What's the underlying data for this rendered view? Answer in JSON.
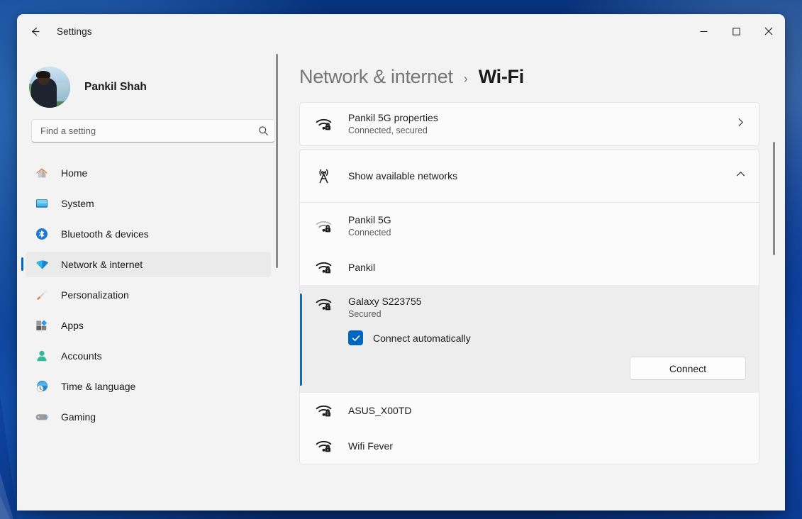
{
  "window": {
    "title": "Settings",
    "back_icon": "back-arrow-icon",
    "minimize_label": "Minimize",
    "maximize_label": "Maximize",
    "close_label": "Close"
  },
  "sidebar": {
    "profile": {
      "name": "Pankil Shah",
      "avatar_icon": "user-avatar"
    },
    "search": {
      "placeholder": "Find a setting",
      "value": "",
      "icon": "search-icon"
    },
    "items": [
      {
        "label": "Home",
        "icon": "home-icon",
        "active": false
      },
      {
        "label": "System",
        "icon": "system-icon",
        "active": false
      },
      {
        "label": "Bluetooth & devices",
        "icon": "bluetooth-icon",
        "active": false
      },
      {
        "label": "Network & internet",
        "icon": "network-icon",
        "active": true
      },
      {
        "label": "Personalization",
        "icon": "personalization-icon",
        "active": false
      },
      {
        "label": "Apps",
        "icon": "apps-icon",
        "active": false
      },
      {
        "label": "Accounts",
        "icon": "accounts-icon",
        "active": false
      },
      {
        "label": "Time & language",
        "icon": "time-language-icon",
        "active": false
      },
      {
        "label": "Gaming",
        "icon": "gaming-icon",
        "active": false
      }
    ]
  },
  "main": {
    "breadcrumb": {
      "parent": "Network & internet",
      "separator": "›",
      "current": "Wi-Fi"
    },
    "properties_row": {
      "title": "Pankil 5G properties",
      "subtitle": "Connected, secured",
      "icon": "wifi-secured-icon",
      "chevron": "chevron-right-icon"
    },
    "show_networks_row": {
      "title": "Show available networks",
      "icon": "broadcast-tower-icon",
      "chevron": "chevron-up-icon",
      "expanded": true
    },
    "networks": [
      {
        "name": "Pankil 5G",
        "status": "Connected",
        "icon": "wifi-secured-icon",
        "selected": false,
        "signal": "weak"
      },
      {
        "name": "Pankil",
        "status": "",
        "icon": "wifi-secured-icon",
        "selected": false,
        "signal": "strong"
      },
      {
        "name": "Galaxy S223755",
        "status": "Secured",
        "icon": "wifi-secured-icon",
        "selected": true,
        "signal": "strong"
      },
      {
        "name": "ASUS_X00TD",
        "status": "",
        "icon": "wifi-secured-icon",
        "selected": false,
        "signal": "strong"
      },
      {
        "name": "Wifi Fever",
        "status": "",
        "icon": "wifi-secured-icon",
        "selected": false,
        "signal": "strong"
      }
    ],
    "selected_network": {
      "checkbox_label": "Connect automatically",
      "checkbox_checked": true,
      "connect_button": "Connect"
    }
  },
  "colors": {
    "accent": "#0067C0",
    "selected_bar": "#1B6FA8",
    "window_bg": "#F3F3F3",
    "card_bg": "#FBFBFB",
    "selected_card_bg": "#EDEDED",
    "text_primary": "#1B1B1B",
    "text_secondary": "#5D5D5D"
  }
}
